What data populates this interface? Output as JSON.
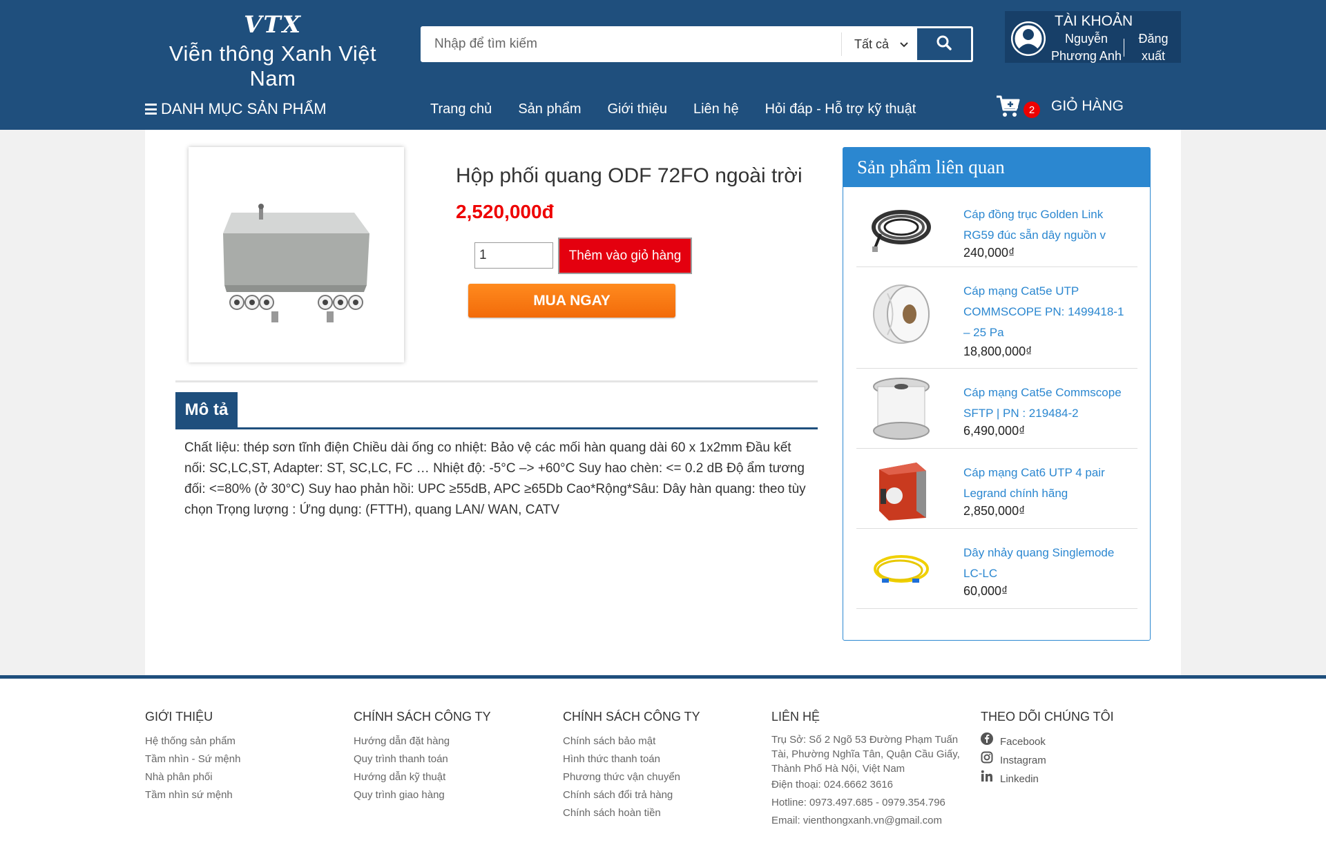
{
  "brand": {
    "mark": "VTX",
    "name": "Viễn thông Xanh Việt Nam"
  },
  "search": {
    "placeholder": "Nhập để tìm kiếm",
    "category": "Tất cả"
  },
  "account": {
    "title": "TÀI KHOẢN",
    "user": "Nguyễn Phương Anh",
    "logout": "Đăng xuất"
  },
  "nav": {
    "menu_label": "DANH MỤC SẢN PHẨM",
    "links": [
      "Trang chủ",
      "Sản phẩm",
      "Giới thiệu",
      "Liên hệ",
      "Hỏi đáp - Hỗ trợ kỹ thuật"
    ],
    "cart_count": "2",
    "cart_label": "GIỎ HÀNG"
  },
  "product": {
    "title": "Hộp phối quang ODF 72FO ngoài trời",
    "price": "2,520,000đ",
    "quantity": "1",
    "add_to_cart": "Thêm vào giỏ hàng",
    "buy_now": "MUA NGAY"
  },
  "description": {
    "tab": "Mô tả",
    "text": "Chất liệu: thép sơn tĩnh điện Chiều dài ống co nhiệt: Bảo vệ các mối hàn quang dài 60 x 1x2mm Đầu kết nối: SC,LC,ST, Adapter: ST, SC,LC, FC … Nhiệt độ: -5°C –> +60°C Suy hao chèn: <= 0.2 dB Độ ẩm tương đối: <=80% (ở 30°C) Suy hao phản hồi: UPC ≥55dB, APC ≥65Db Cao*Rộng*Sâu: Dây hàn quang: theo tùy chọn Trọng lượng : Ứng dụng: (FTTH), quang LAN/ WAN, CATV"
  },
  "related": {
    "title": "Sản phẩm liên quan",
    "items": [
      {
        "name": "Cáp đồng trục Golden Link RG59 đúc sẵn dây nguồn v",
        "price": "240,000₫",
        "icon": "coax-cable-coil"
      },
      {
        "name": "Cáp mạng Cat5e UTP COMMSCOPE PN: 1499418-1 – 25 Pa",
        "price": "18,800,000₫",
        "icon": "cable-spool-white"
      },
      {
        "name": "Cáp mạng Cat5e Commscope SFTP | PN : 219484-2",
        "price": "6,490,000₫",
        "icon": "cable-spool-reel"
      },
      {
        "name": "Cáp mạng Cat6 UTP 4 pair Legrand chính hãng",
        "price": "2,850,000₫",
        "icon": "cable-box"
      },
      {
        "name": "Dây nhảy quang Singlemode LC-LC",
        "price": "60,000₫",
        "icon": "fiber-patch-cord"
      }
    ]
  },
  "footer": {
    "about": {
      "title": "GIỚI THIỆU",
      "links": [
        "Hệ thống sản phẩm",
        "Tầm nhìn - Sứ mệnh",
        "Nhà phân phối",
        "Tầm nhìn sứ mệnh"
      ]
    },
    "policy1": {
      "title": "CHÍNH SÁCH CÔNG TY",
      "links": [
        "Hướng dẫn đặt hàng",
        "Quy trình thanh toán",
        "Hướng dẫn kỹ thuật",
        "Quy trình giao hàng"
      ]
    },
    "policy2": {
      "title": "CHÍNH SÁCH CÔNG TY",
      "links": [
        "Chính sách bảo mật",
        "Hình thức thanh toán",
        "Phương thức vận chuyển",
        "Chính sách đổi trả hàng",
        "Chính sách hoàn tiền"
      ]
    },
    "contact": {
      "title": "LIÊN HỆ",
      "address": "Trụ Sở: Số 2 Ngõ 53 Đường Phạm Tuấn Tài, Phường Nghĩa Tân, Quận Cầu Giấy, Thành Phố Hà Nội, Việt Nam",
      "phone": "Điện thoại: 024.6662 3616",
      "hotline": "Hotline: 0973.497.685 - 0979.354.796",
      "email": "Email: vienthongxanh.vn@gmail.com"
    },
    "follow": {
      "title": "THEO DÕI CHÚNG TÔI",
      "facebook": "Facebook",
      "instagram": "Instagram",
      "linkedin": "Linkedin"
    }
  },
  "colors": {
    "primary": "#1f4f7d",
    "accent_blue": "#2b87d0",
    "price_red": "#e00000",
    "buy_orange": "#f47b12"
  }
}
